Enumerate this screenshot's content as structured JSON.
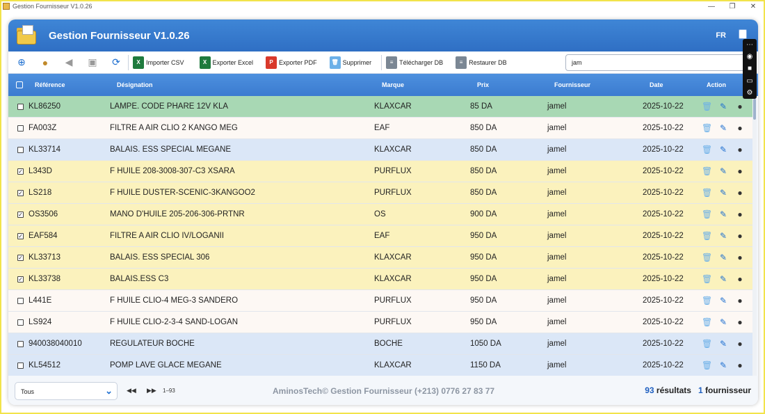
{
  "window": {
    "title": "Gestion Fournisseur V1.0.26",
    "controls": [
      "—",
      "❐",
      "✕"
    ]
  },
  "header": {
    "title": "Gestion Fournisseur V1.0.26",
    "lang": "FR"
  },
  "toolbar": {
    "import_csv": "Importer CSV",
    "export_excel": "Exporter Excel",
    "export_pdf": "Exporter PDF",
    "delete": "Supprimer",
    "download_db": "Télécharger DB",
    "restore_db": "Restaurer DB"
  },
  "search": {
    "value": "jam"
  },
  "columns": {
    "reference": "Référence",
    "designation": "Désignation",
    "marque": "Marque",
    "prix": "Prix",
    "fournisseur": "Fournisseur",
    "date": "Date",
    "action": "Action"
  },
  "rows": [
    {
      "ref": "KL86250",
      "designation": "LAMPE. CODE PHARE  12V   KLA",
      "marque": "KLAXCAR",
      "prix": "85 DA",
      "fournisseur": "jamel",
      "date": "2025-10-22",
      "checked": false,
      "color": "#a8d8b4"
    },
    {
      "ref": "FA003Z",
      "designation": "FILTRE A AIR CLIO 2 KANGO MEG",
      "marque": "EAF",
      "prix": "850 DA",
      "fournisseur": "jamel",
      "date": "2025-10-22",
      "checked": false,
      "color": "#fdf8f4"
    },
    {
      "ref": "KL33714",
      "designation": "BALAIS. ESS SPECIAL MEGANE",
      "marque": "KLAXCAR",
      "prix": "850 DA",
      "fournisseur": "jamel",
      "date": "2025-10-22",
      "checked": false,
      "color": "#dbe7f7"
    },
    {
      "ref": "L343D",
      "designation": "F HUILE 208-3008-307-C3 XSARA",
      "marque": "PURFLUX",
      "prix": "850 DA",
      "fournisseur": "jamel",
      "date": "2025-10-22",
      "checked": true,
      "color": "#fbf2bd"
    },
    {
      "ref": "LS218",
      "designation": "F HUILE DUSTER-SCENIC-3KANGOO2",
      "marque": "PURFLUX",
      "prix": "850 DA",
      "fournisseur": "jamel",
      "date": "2025-10-22",
      "checked": true,
      "color": "#fbf2bd"
    },
    {
      "ref": "OS3506",
      "designation": "MANO D'HUILE 205-206-306-PRTNR",
      "marque": "OS",
      "prix": "900 DA",
      "fournisseur": "jamel",
      "date": "2025-10-22",
      "checked": true,
      "color": "#fbf2bd"
    },
    {
      "ref": "EAF584",
      "designation": "FILTRE A AIR CLIO IV/LOGANII",
      "marque": "EAF",
      "prix": "950 DA",
      "fournisseur": "jamel",
      "date": "2025-10-22",
      "checked": true,
      "color": "#fbf2bd"
    },
    {
      "ref": "KL33713",
      "designation": "BALAIS. ESS SPECIAL 306",
      "marque": "KLAXCAR",
      "prix": "950 DA",
      "fournisseur": "jamel",
      "date": "2025-10-22",
      "checked": true,
      "color": "#fbf2bd"
    },
    {
      "ref": "KL33738",
      "designation": "BALAIS.ESS C3",
      "marque": "KLAXCAR",
      "prix": "950 DA",
      "fournisseur": "jamel",
      "date": "2025-10-22",
      "checked": true,
      "color": "#fbf2bd"
    },
    {
      "ref": "L441E",
      "designation": "F HUILE CLIO-4 MEG-3 SANDERO",
      "marque": "PURFLUX",
      "prix": "950 DA",
      "fournisseur": "jamel",
      "date": "2025-10-22",
      "checked": false,
      "color": "#fdf8f4"
    },
    {
      "ref": "LS924",
      "designation": "F HUILE CLIO-2-3-4 SAND-LOGAN",
      "marque": "PURFLUX",
      "prix": "950 DA",
      "fournisseur": "jamel",
      "date": "2025-10-22",
      "checked": false,
      "color": "#fdf8f4"
    },
    {
      "ref": "940038040010",
      "designation": "REGULATEUR BOCHE",
      "marque": "BOCHE",
      "prix": "1050 DA",
      "fournisseur": "jamel",
      "date": "2025-10-22",
      "checked": false,
      "color": "#dbe7f7"
    },
    {
      "ref": "KL54512",
      "designation": "POMP LAVE GLACE  MEGANE",
      "marque": "KLAXCAR",
      "prix": "1150 DA",
      "fournisseur": "jamel",
      "date": "2025-10-22",
      "checked": false,
      "color": "#dbe7f7"
    }
  ],
  "footer": {
    "filter_value": "Tous",
    "page_range": "1–93",
    "copyright": "AminosTech© Gestion Fournisseur (+213) 0776 27 83 77",
    "results_count": "93",
    "results_label": "résultats",
    "supplier_count": "1",
    "supplier_label": "fournisseur"
  }
}
